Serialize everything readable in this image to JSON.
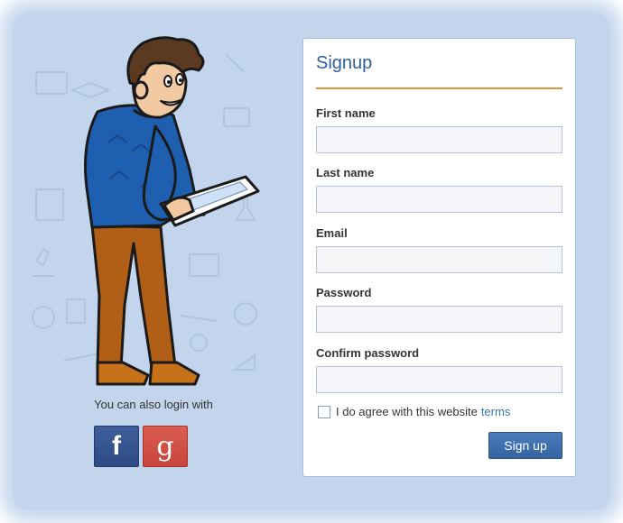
{
  "colors": {
    "panel_bg": "#c2d5ec",
    "title_blue": "#2f5f9f",
    "accent_orange": "#e59432",
    "button_blue": "#3a6aa8",
    "facebook": "#3b5998",
    "google": "#d34f45",
    "link": "#3a74b8"
  },
  "left": {
    "alt_login_text": "You can also login with",
    "social": [
      {
        "label": "f",
        "icon": "facebook-icon"
      },
      {
        "label": "g",
        "icon": "google-plus-icon"
      }
    ]
  },
  "form": {
    "title": "Signup",
    "fields": [
      {
        "label": "First name",
        "value": "",
        "placeholder": ""
      },
      {
        "label": "Last name",
        "value": "",
        "placeholder": ""
      },
      {
        "label": "Email",
        "value": "",
        "placeholder": ""
      },
      {
        "label": "Password",
        "value": "",
        "placeholder": ""
      },
      {
        "label": "Confirm password",
        "value": "",
        "placeholder": ""
      }
    ],
    "agree_text": "I do agree with this website",
    "terms_link": "terms",
    "submit_label": "Sign up"
  }
}
